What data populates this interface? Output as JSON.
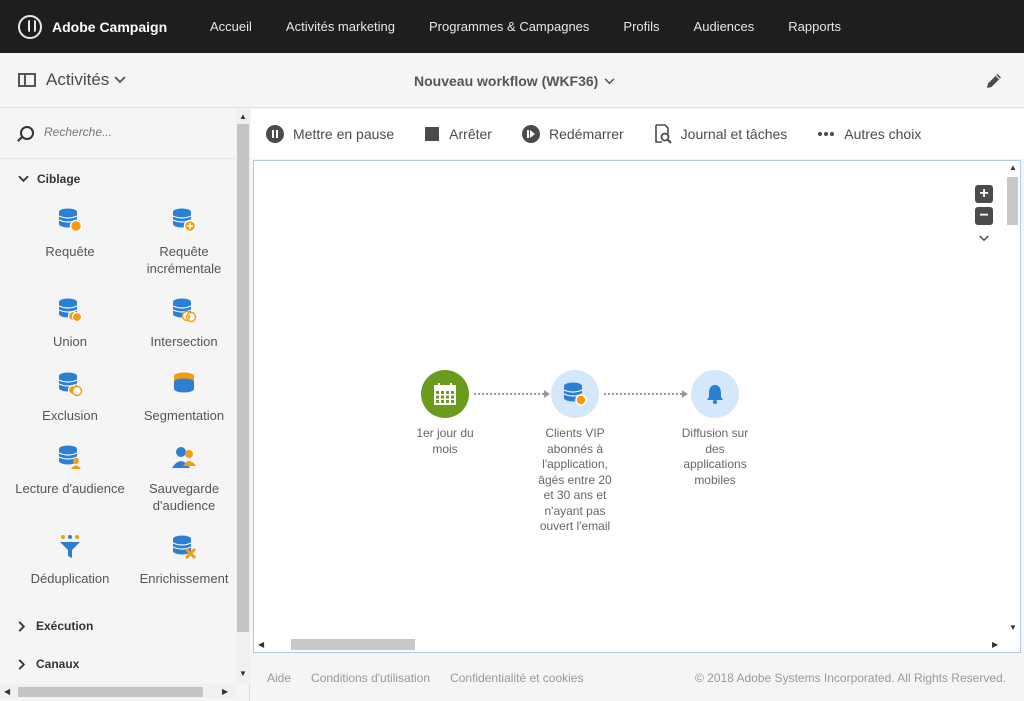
{
  "app": {
    "name": "Adobe Campaign"
  },
  "nav": [
    "Accueil",
    "Activités marketing",
    "Programmes & Campagnes",
    "Profils",
    "Audiences",
    "Rapports"
  ],
  "header": {
    "panel_title": "Activités",
    "workflow_title": "Nouveau workflow (WKF36)"
  },
  "search": {
    "placeholder": "Recherche..."
  },
  "sections": {
    "ciblage": "Ciblage",
    "execution": "Exécution",
    "canaux": "Canaux"
  },
  "activities": {
    "requete": "Requête",
    "requete_inc_1": "Requête",
    "requete_inc_2": "incrémentale",
    "union": "Union",
    "intersection": "Intersection",
    "exclusion": "Exclusion",
    "segmentation": "Segmentation",
    "lecture": "Lecture d'audience",
    "sauvegarde_1": "Sauvegarde",
    "sauvegarde_2": "d'audience",
    "deduplication": "Déduplication",
    "enrichissement": "Enrichissement"
  },
  "toolbar": {
    "pause": "Mettre en pause",
    "stop": "Arrêter",
    "restart": "Redémarrer",
    "journal": "Journal et tâches",
    "more": "Autres choix"
  },
  "workflow": {
    "nodes": [
      {
        "label": [
          "1er jour du",
          "mois"
        ],
        "icon": "calendar-icon",
        "color": "#6b9a1d"
      },
      {
        "label": [
          "Clients VIP",
          "abonnés à",
          "l'application,",
          "âgés entre 20",
          "et 30 ans et",
          "n'ayant pas",
          "ouvert l'email"
        ],
        "icon": "database-query-icon",
        "color": "#d5e7fa"
      },
      {
        "label": [
          "Diffusion sur",
          "des",
          "applications",
          "mobiles"
        ],
        "icon": "bell-icon",
        "color": "#d5e7fa"
      }
    ]
  },
  "footer": {
    "help": "Aide",
    "terms": "Conditions d'utilisation",
    "privacy": "Confidentialité et cookies",
    "copyright": "© 2018 Adobe Systems Incorporated. All Rights Reserved."
  },
  "colors": {
    "accent_blue": "#2d7fd3",
    "orange": "#f39c12",
    "green": "#6b9a1d"
  }
}
